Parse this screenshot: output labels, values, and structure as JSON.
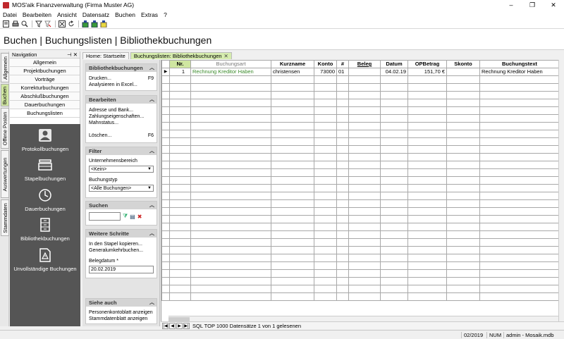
{
  "window": {
    "title": "MOS'aik Finanzverwaltung (Firma Muster AG)",
    "minimize": "–",
    "restore": "❐",
    "close": "✕"
  },
  "menu": [
    "Datei",
    "Bearbeiten",
    "Ansicht",
    "Datensatz",
    "Buchen",
    "Extras",
    "?"
  ],
  "toolbar_icons": [
    "new-doc-icon",
    "print-icon",
    "preview-icon",
    "filter-icon",
    "filter-remove-icon",
    "delete-icon",
    "refresh-icon",
    "book-green-icon",
    "book-blue-icon",
    "book-yellow-icon"
  ],
  "header": {
    "title": "Buchen | Buchungslisten | Bibliothekbuchungen"
  },
  "vtabs": [
    "Allgemein",
    "Buchen",
    "Offene Posten",
    "Auswertungen",
    "Stammdaten"
  ],
  "navigation": {
    "title": "Navigation",
    "pin": "⊣",
    "close": "✕",
    "items": [
      "Allgemein",
      "Projektbuchungen",
      "Vorträge",
      "Korrekturbuchungen",
      "Abschlußbuchungen",
      "Dauerbuchungen",
      "Buchungslisten"
    ],
    "big_buttons": [
      "Protokollbuchungen",
      "Stapelbuchungen",
      "Dauerbuchungen",
      "Bibliothekbuchungen",
      "Unvollständige Buchungen"
    ]
  },
  "tabs": [
    {
      "label": "Home: Startseite"
    },
    {
      "label": "Buchungslisten: Bibliothekbuchungen",
      "close": "✕"
    }
  ],
  "tasks": {
    "bibliothek": {
      "title": "Bibliothekbuchungen",
      "drucken": "Drucken...",
      "drucken_key": "F9",
      "analysieren": "Analysieren in Excel..."
    },
    "bearbeiten": {
      "title": "Bearbeiten",
      "adresse": "Adresse und Bank...",
      "zahlung": "Zahlungseigenschaften...",
      "mahn": "Mahnstatus...",
      "loeschen": "Löschen...",
      "loeschen_key": "F6"
    },
    "filter": {
      "title": "Filter",
      "unternehmensbereich_label": "Unternehmensbereich",
      "unternehmensbereich_value": "<Kein>",
      "buchungstyp_label": "Buchungstyp",
      "buchungstyp_value": "<Alle Buchungen>"
    },
    "suchen": {
      "title": "Suchen",
      "value": ""
    },
    "weitere": {
      "title": "Weitere Schritte",
      "stapel": "In den Stapel kopieren...",
      "general": "Generalumkehrbuchen...",
      "belegdatum_label": "Belegdatum *",
      "belegdatum_value": "20.02.2019"
    },
    "siehe": {
      "title": "Siehe auch",
      "personen": "Personenkontoblatt anzeigen",
      "stamm": "Stammdatenblatt anzeigen"
    }
  },
  "grid": {
    "columns": [
      "Nr.",
      "Buchungsart",
      "Kurzname",
      "Konto",
      "#",
      "Beleg",
      "Datum",
      "OPBetrag",
      "Skonto",
      "Buchungstext"
    ],
    "rows": [
      {
        "nr": "1",
        "buchungsart": "Rechnung Kreditor Haben",
        "kurzname": "christensen",
        "konto": "73000",
        "hash": "01",
        "beleg": "",
        "datum": "04.02.19",
        "opbetrag": "151,70 €",
        "skonto": "",
        "text": "Rechnung Kreditor Haben"
      }
    ]
  },
  "record_nav": {
    "text": "SQL TOP 1000 Datensätze 1 von 1 gelesenen"
  },
  "status": {
    "period": "02/2019",
    "num": "NUM",
    "user": "admin - Mosaik.mdb"
  }
}
